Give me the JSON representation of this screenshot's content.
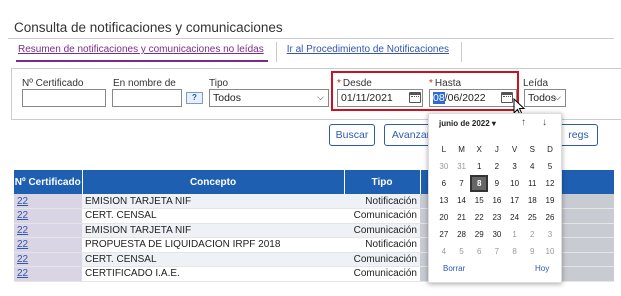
{
  "page": {
    "title": "Consulta de notificaciones y comunicaciones"
  },
  "tabs": [
    {
      "label": "Resumen de notificaciones y comunicaciones no leídas"
    },
    {
      "label": "Ir al Procedimiento de Notificaciones"
    }
  ],
  "filters": {
    "certificado_label": "Nº Certificado",
    "certificado_value": "",
    "nombre_label": "En nombre de",
    "nombre_value": "",
    "help_label": "?",
    "tipo_label": "Tipo",
    "tipo_value": "Todos",
    "desde_req": "*",
    "desde_label": "Desde",
    "desde_value": "01/11/2021",
    "hasta_req": "*",
    "hasta_label": "Hasta",
    "hasta_selected": "08",
    "hasta_rest": "/06/2022",
    "leida_label": "Leída",
    "leida_value": "Todos"
  },
  "buttons": {
    "buscar": "Buscar",
    "avanzar": "Avanzar",
    "regs": "regs"
  },
  "table": {
    "headers": [
      "Nº Certificado",
      "Concepto",
      "Tipo"
    ],
    "rows": [
      {
        "num": "22",
        "concepto": "EMISION TARJETA NIF",
        "tipo": "Notificación"
      },
      {
        "num": "22",
        "concepto": "CERT. CENSAL",
        "tipo": "Comunicación"
      },
      {
        "num": "22",
        "concepto": "EMISION TARJETA NIF",
        "tipo": "Comunicación"
      },
      {
        "num": "22",
        "concepto": "PROPUESTA DE LIQUIDACION IRPF 2018",
        "tipo": "Notificación"
      },
      {
        "num": "22",
        "concepto": "CERT. CENSAL",
        "tipo": "Comunicación"
      },
      {
        "num": "22",
        "concepto": "CERTIFICADO I.A.E.",
        "tipo": "Comunicación"
      }
    ]
  },
  "calendar": {
    "month": "junio de 2022",
    "weekdays": [
      "L",
      "M",
      "X",
      "J",
      "V",
      "S",
      "D"
    ],
    "weeks": [
      [
        "30",
        "31",
        "1",
        "2",
        "3",
        "4",
        "5"
      ],
      [
        "6",
        "7",
        "8",
        "9",
        "10",
        "11",
        "12"
      ],
      [
        "13",
        "14",
        "15",
        "16",
        "17",
        "18",
        "19"
      ],
      [
        "20",
        "21",
        "22",
        "23",
        "24",
        "25",
        "26"
      ],
      [
        "27",
        "28",
        "29",
        "30",
        "1",
        "2",
        "3"
      ],
      [
        "4",
        "5",
        "6",
        "7",
        "8",
        "9",
        "10"
      ]
    ],
    "selected": "8",
    "clear_label": "Borrar",
    "today_label": "Hoy"
  },
  "icons": {
    "calendar": "calendar-icon",
    "dropdown": "chevron-down-icon",
    "up": "arrow-up-icon",
    "down": "arrow-down-icon"
  }
}
